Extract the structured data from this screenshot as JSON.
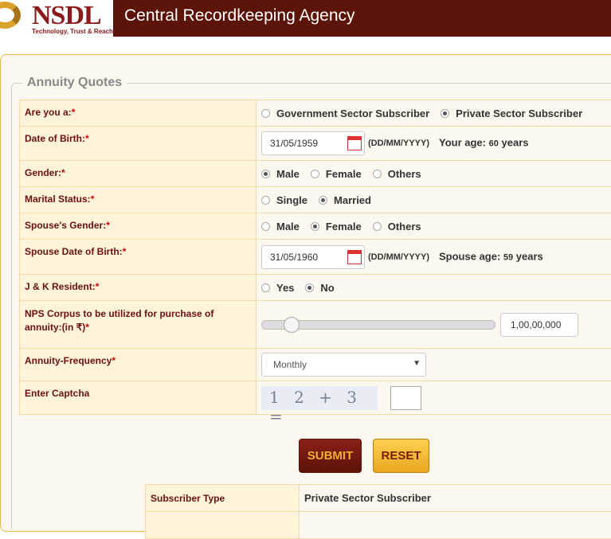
{
  "header": {
    "logo_name": "NSDL",
    "logo_tagline": "Technology, Trust & Reach",
    "title": "Central Recordkeeping Agency"
  },
  "legend": "Annuity Quotes",
  "form": {
    "subscriber": {
      "label": "Are you a:",
      "options": [
        "Government Sector Subscriber",
        "Private Sector Subscriber"
      ],
      "selected": 1
    },
    "dob": {
      "label": "Date of Birth:",
      "value": "31/05/1959",
      "format": "(DD/MM/YYYY)",
      "age_label": "Your age:",
      "age": "60",
      "age_unit": "years"
    },
    "gender": {
      "label": "Gender:",
      "options": [
        "Male",
        "Female",
        "Others"
      ],
      "selected": 0
    },
    "marital": {
      "label": "Marital Status:",
      "options": [
        "Single",
        "Married"
      ],
      "selected": 1
    },
    "spouse_gender": {
      "label": "Spouse's Gender:",
      "options": [
        "Male",
        "Female",
        "Others"
      ],
      "selected": 1
    },
    "spouse_dob": {
      "label": "Spouse Date of Birth:",
      "value": "31/05/1960",
      "format": "(DD/MM/YYYY)",
      "age_label": "Spouse age:",
      "age": "59",
      "age_unit": "years"
    },
    "jk": {
      "label": "J & K Resident:",
      "options": [
        "Yes",
        "No"
      ],
      "selected": 1
    },
    "corpus": {
      "label": "NPS Corpus to be utilized for purchase of annuity:(in ₹)",
      "value": "1,00,00,000",
      "slider_fraction": 0.1
    },
    "frequency": {
      "label": "Annuity-Frequency",
      "value": "Monthly"
    },
    "captcha": {
      "label": "Enter Captcha",
      "image_text": "1 2 + 3 ="
    }
  },
  "buttons": {
    "submit": "SUBMIT",
    "reset": "RESET"
  },
  "result": {
    "label": "Subscriber Type",
    "value": "Private Sector Subscriber"
  }
}
